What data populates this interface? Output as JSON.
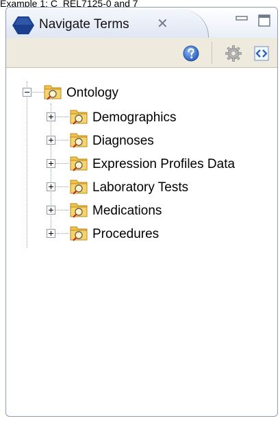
{
  "caption": "Example 1: C_REL7125-0 and 7",
  "view": {
    "tab_title": "Navigate Terms",
    "close_glyph": "✕",
    "icons": {
      "tab": "ontology-view-icon",
      "minimize": "minimize-icon",
      "maximize": "maximize-icon",
      "help": "help-icon",
      "settings": "gear-icon",
      "link": "link-arrows-icon"
    }
  },
  "tree": {
    "root": {
      "label": "Ontology",
      "expanded": true
    },
    "children": [
      {
        "label": "Demographics",
        "expanded": false
      },
      {
        "label": "Diagnoses",
        "expanded": false
      },
      {
        "label": "Expression Profiles Data",
        "expanded": false
      },
      {
        "label": "Laboratory Tests",
        "expanded": false
      },
      {
        "label": "Medications",
        "expanded": false
      },
      {
        "label": "Procedures",
        "expanded": false
      }
    ]
  },
  "colors": {
    "tab_icon": "#1a3f8e",
    "folder": "#f3c24a",
    "toolbar_bg": "#eeebde",
    "border": "#8e9ab4"
  }
}
